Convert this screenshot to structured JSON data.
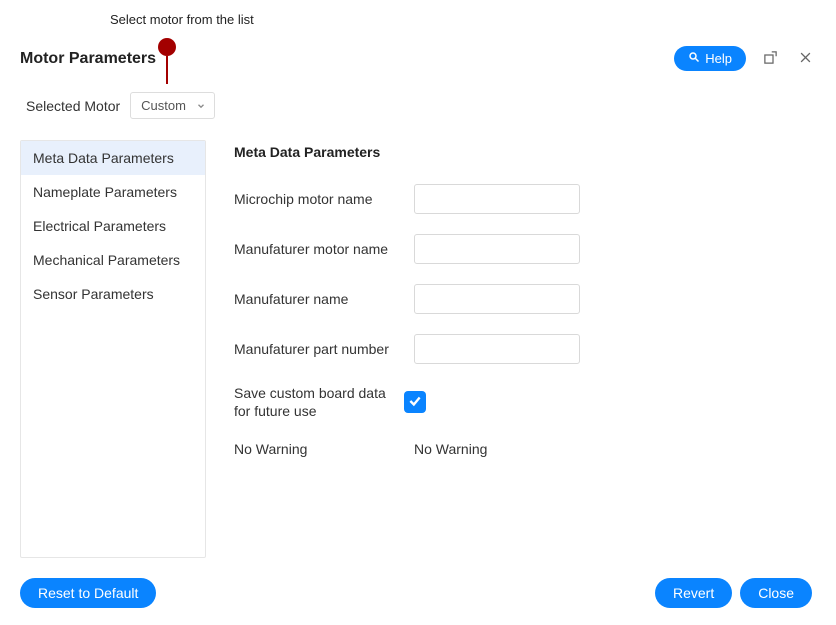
{
  "annotation": {
    "text": "Select motor from the list"
  },
  "header": {
    "title": "Motor Parameters",
    "help_label": "Help"
  },
  "selector": {
    "label": "Selected Motor",
    "value": "Custom"
  },
  "sidebar": {
    "items": [
      {
        "label": "Meta Data Parameters",
        "active": true
      },
      {
        "label": "Nameplate Parameters",
        "active": false
      },
      {
        "label": "Electrical Parameters",
        "active": false
      },
      {
        "label": "Mechanical Parameters",
        "active": false
      },
      {
        "label": "Sensor Parameters",
        "active": false
      }
    ]
  },
  "content": {
    "title": "Meta Data Parameters",
    "fields": {
      "microchip_motor_name": {
        "label": "Microchip motor name",
        "value": ""
      },
      "manufacturer_motor_name": {
        "label": "Manufaturer motor name",
        "value": ""
      },
      "manufacturer_name": {
        "label": "Manufaturer name",
        "value": ""
      },
      "manufacturer_part_number": {
        "label": "Manufaturer part number",
        "value": ""
      },
      "save_custom": {
        "label": "Save custom board data for future use",
        "checked": true
      },
      "warning": {
        "label": "No Warning",
        "value": "No Warning"
      }
    }
  },
  "footer": {
    "reset_label": "Reset to Default",
    "revert_label": "Revert",
    "close_label": "Close"
  }
}
